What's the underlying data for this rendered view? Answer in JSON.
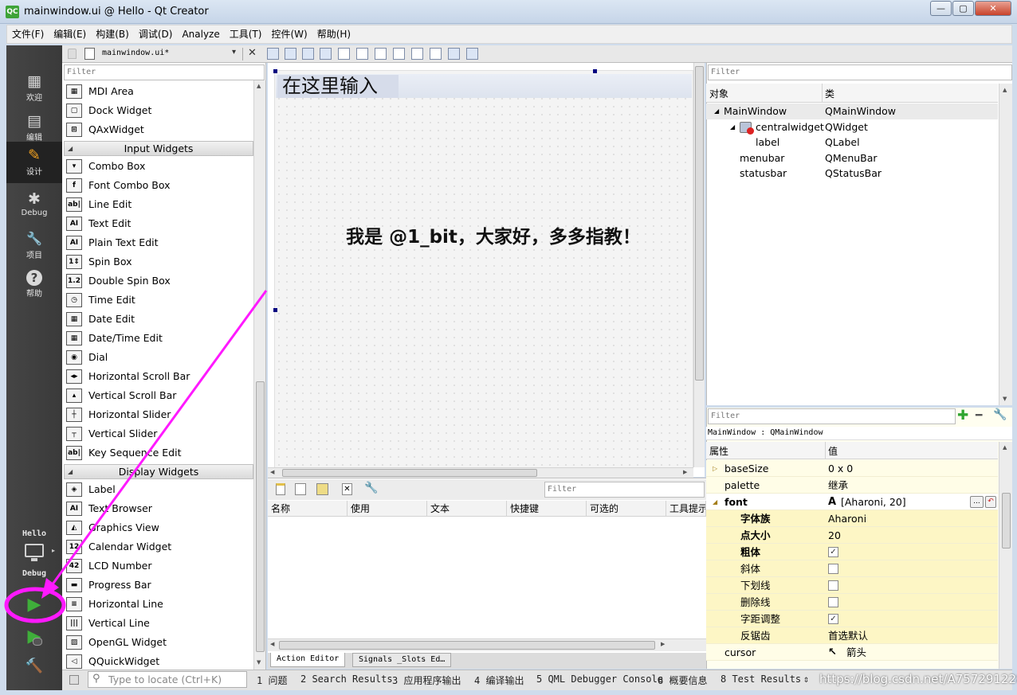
{
  "window": {
    "app_icon": "QC",
    "title": "mainwindow.ui @ Hello - Qt Creator",
    "min_glyph": "—",
    "max_glyph": "▢",
    "close_glyph": "✕"
  },
  "menubar": [
    "文件(F)",
    "编辑(E)",
    "构建(B)",
    "调试(D)",
    "Analyze",
    "工具(T)",
    "控件(W)",
    "帮助(H)"
  ],
  "modes": [
    {
      "icon": "grid-icon",
      "glyph": "▦",
      "label": "欢迎"
    },
    {
      "icon": "document-icon",
      "glyph": "▤",
      "label": "编辑"
    },
    {
      "icon": "pencil-icon",
      "glyph": "✎",
      "label": "设计",
      "active": true
    },
    {
      "icon": "bug-icon",
      "glyph": "✱",
      "label": "Debug"
    },
    {
      "icon": "wrench-icon",
      "glyph": "🔧",
      "label": "项目"
    },
    {
      "icon": "help-icon",
      "glyph": "?",
      "label": "帮助"
    }
  ],
  "kit": {
    "project": "Hello",
    "config": "Debug"
  },
  "run_buttons": {
    "run_glyph": "▶",
    "debug_run_glyph": "▶",
    "build_glyph": "🔨"
  },
  "doc_tab": {
    "file": "mainwindow.ui*",
    "dropdown_glyph": "▾",
    "close_glyph": "✕"
  },
  "widget_box": {
    "filter_placeholder": "Filter",
    "items": [
      {
        "type": "item",
        "label": "MDI Area",
        "icon": "mdi-area-icon",
        "glyph": "▦"
      },
      {
        "type": "item",
        "label": "Dock Widget",
        "icon": "dock-widget-icon",
        "glyph": "▢"
      },
      {
        "type": "item",
        "label": "QAxWidget",
        "icon": "qaxwidget-icon",
        "glyph": "⊞"
      },
      {
        "type": "category",
        "label": "Input Widgets"
      },
      {
        "type": "item",
        "label": "Combo Box",
        "icon": "combo-box-icon",
        "glyph": "▾"
      },
      {
        "type": "item",
        "label": "Font Combo Box",
        "icon": "font-combo-box-icon",
        "glyph": "f"
      },
      {
        "type": "item",
        "label": "Line Edit",
        "icon": "line-edit-icon",
        "glyph": "ab|"
      },
      {
        "type": "item",
        "label": "Text Edit",
        "icon": "text-edit-icon",
        "glyph": "AI"
      },
      {
        "type": "item",
        "label": "Plain Text Edit",
        "icon": "plain-text-edit-icon",
        "glyph": "AI"
      },
      {
        "type": "item",
        "label": "Spin Box",
        "icon": "spin-box-icon",
        "glyph": "1⇕"
      },
      {
        "type": "item",
        "label": "Double Spin Box",
        "icon": "double-spin-box-icon",
        "glyph": "1.2"
      },
      {
        "type": "item",
        "label": "Time Edit",
        "icon": "time-edit-icon",
        "glyph": "◷"
      },
      {
        "type": "item",
        "label": "Date Edit",
        "icon": "date-edit-icon",
        "glyph": "▦"
      },
      {
        "type": "item",
        "label": "Date/Time Edit",
        "icon": "date-time-edit-icon",
        "glyph": "▦"
      },
      {
        "type": "item",
        "label": "Dial",
        "icon": "dial-icon",
        "glyph": "◉"
      },
      {
        "type": "item",
        "label": "Horizontal Scroll Bar",
        "icon": "horizontal-scroll-bar-icon",
        "glyph": "◂▸"
      },
      {
        "type": "item",
        "label": "Vertical Scroll Bar",
        "icon": "vertical-scroll-bar-icon",
        "glyph": "▴"
      },
      {
        "type": "item",
        "label": "Horizontal Slider",
        "icon": "horizontal-slider-icon",
        "glyph": "┼"
      },
      {
        "type": "item",
        "label": "Vertical Slider",
        "icon": "vertical-slider-icon",
        "glyph": "┬"
      },
      {
        "type": "item",
        "label": "Key Sequence Edit",
        "icon": "key-sequence-edit-icon",
        "glyph": "ab|"
      },
      {
        "type": "category",
        "label": "Display Widgets"
      },
      {
        "type": "item",
        "label": "Label",
        "icon": "label-icon",
        "glyph": "◈"
      },
      {
        "type": "item",
        "label": "Text Browser",
        "icon": "text-browser-icon",
        "glyph": "AI"
      },
      {
        "type": "item",
        "label": "Graphics View",
        "icon": "graphics-view-icon",
        "glyph": "◭"
      },
      {
        "type": "item",
        "label": "Calendar Widget",
        "icon": "calendar-widget-icon",
        "glyph": "12"
      },
      {
        "type": "item",
        "label": "LCD Number",
        "icon": "lcd-number-icon",
        "glyph": "42"
      },
      {
        "type": "item",
        "label": "Progress Bar",
        "icon": "progress-bar-icon",
        "glyph": "▬"
      },
      {
        "type": "item",
        "label": "Horizontal Line",
        "icon": "horizontal-line-icon",
        "glyph": "≡"
      },
      {
        "type": "item",
        "label": "Vertical Line",
        "icon": "vertical-line-icon",
        "glyph": "|||"
      },
      {
        "type": "item",
        "label": "OpenGL Widget",
        "icon": "opengl-widget-icon",
        "glyph": "▨"
      },
      {
        "type": "item",
        "label": "QQuickWidget",
        "icon": "qquickwidget-icon",
        "glyph": "◁"
      }
    ]
  },
  "form": {
    "menu_placeholder": "在这里输入",
    "label_text": "我是 @1_bit，大家好，多多指教！"
  },
  "action_editor": {
    "filter_placeholder": "Filter",
    "columns": [
      "名称",
      "使用",
      "文本",
      "快捷键",
      "可选的",
      "工具提示"
    ],
    "tabs": [
      "Action Editor",
      "Signals _Slots Ed…"
    ]
  },
  "object_inspector": {
    "filter_placeholder": "Filter",
    "columns": [
      "对象",
      "类"
    ],
    "rows": [
      {
        "name": "MainWindow",
        "class": "QMainWindow",
        "depth": 0,
        "expand": "◢"
      },
      {
        "name": "centralwidget",
        "class": "QWidget",
        "depth": 1,
        "expand": "◢",
        "icon": "broken-layout-icon"
      },
      {
        "name": "label",
        "class": "QLabel",
        "depth": 2,
        "expand": ""
      },
      {
        "name": "menubar",
        "class": "QMenuBar",
        "depth": 1,
        "expand": ""
      },
      {
        "name": "statusbar",
        "class": "QStatusBar",
        "depth": 1,
        "expand": ""
      }
    ]
  },
  "property_editor": {
    "filter_placeholder": "Filter",
    "add_glyph": "✚",
    "remove_glyph": "━",
    "config_glyph": "🔧",
    "title": "MainWindow : QMainWindow",
    "columns": [
      "属性",
      "值"
    ],
    "rows": [
      {
        "name": "baseSize",
        "value": "0 x 0",
        "kind": "group",
        "expand": "▷",
        "bold": false
      },
      {
        "name": "palette",
        "value": "继承",
        "kind": "group",
        "expand": "",
        "bold": false
      },
      {
        "name": "font",
        "value": "[Aharoni, 20]",
        "kind": "group",
        "expand": "◢",
        "bold": true,
        "value_icon": "font-icon",
        "value_glyph": "A",
        "browse_glyph": "...",
        "reset_glyph": "↶"
      },
      {
        "name": "字体族",
        "value": "Aharoni",
        "kind": "sub",
        "bold": true
      },
      {
        "name": "点大小",
        "value": "20",
        "kind": "sub",
        "bold": true
      },
      {
        "name": "粗体",
        "checked": true,
        "kind": "sub-check",
        "bold": true
      },
      {
        "name": "斜体",
        "checked": false,
        "kind": "sub-check",
        "bold": false
      },
      {
        "name": "下划线",
        "checked": false,
        "kind": "sub-check",
        "bold": false
      },
      {
        "name": "删除线",
        "checked": false,
        "kind": "sub-check",
        "bold": false
      },
      {
        "name": "字距调整",
        "checked": true,
        "kind": "sub-check",
        "bold": false
      },
      {
        "name": "反锯齿",
        "value": "首选默认",
        "kind": "sub",
        "bold": false
      },
      {
        "name": "cursor",
        "value": "箭头",
        "kind": "group",
        "expand": "",
        "bold": false,
        "value_icon": "arrow-cursor-icon",
        "value_glyph": "↖"
      }
    ]
  },
  "statusbar": {
    "locate_placeholder": "Type to locate (Ctrl+K)",
    "items": [
      "1 问题",
      "2 Search Results",
      "3 应用程序输出",
      "4 编译输出",
      "5 QML Debugger Console",
      "6 概要信息",
      "8 Test Results"
    ],
    "more_glyph": "⇕",
    "watermark": "https://blog.csdn.net/A757291228"
  },
  "colors": {
    "annotation": "#ff19ff",
    "run_green": "#3fae3a"
  }
}
